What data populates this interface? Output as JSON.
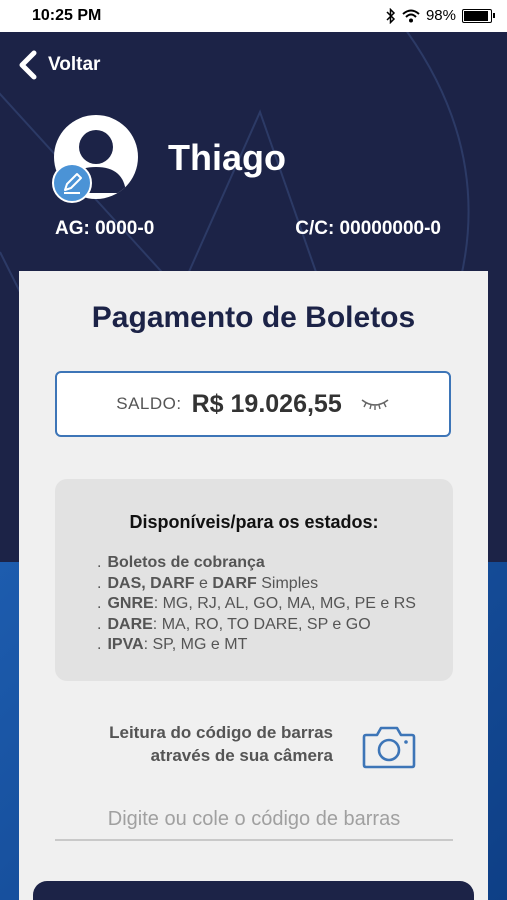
{
  "status_bar": {
    "time": "10:25 PM",
    "battery": "98%"
  },
  "header": {
    "back_label": "Voltar",
    "user_name": "Thiago",
    "agency": "AG: 0000-0",
    "account": "C/C: 00000000-0"
  },
  "main": {
    "title": "Pagamento de Boletos",
    "balance_label": "SALDO:",
    "balance_value": "R$ 19.026,55",
    "states": {
      "title": "Disponíveis/para os estados:",
      "items": [
        {
          "dot": ".",
          "bold": "Boletos de cobrança",
          "rest": ""
        },
        {
          "dot": ".",
          "bold": "DAS, DARF",
          "mid": " e ",
          "bold2": "DARF",
          "rest": " Simples"
        },
        {
          "dot": ".",
          "bold": "GNRE",
          "rest": ": MG, RJ, AL, GO, MA, MG, PE e RS"
        },
        {
          "dot": ".",
          "bold": "DARE",
          "rest": ": MA, RO, TO DARE, SP e GO"
        },
        {
          "dot": ".",
          "bold": "IPVA",
          "rest": ":  SP, MG e MT"
        }
      ]
    },
    "scan_line1": "Leitura do código de barras",
    "scan_line2": "através de sua câmera",
    "barcode_placeholder": "Digite ou cole o código de barras"
  },
  "colors": {
    "navy": "#1c2347",
    "accent_blue": "#3d75b7",
    "badge_blue": "#4b93d6"
  }
}
